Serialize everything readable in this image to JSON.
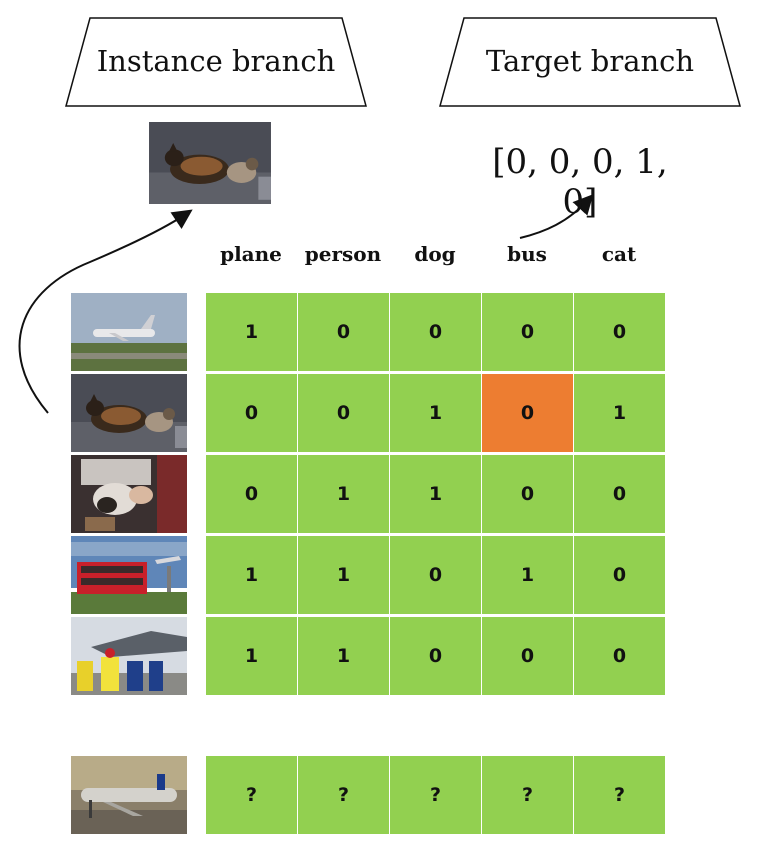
{
  "instance_branch": {
    "label": "Instance branch"
  },
  "target_branch": {
    "label": "Target branch",
    "vector": "[0, 0, 0, 1, 0]"
  },
  "columns": [
    "plane",
    "person",
    "dog",
    "bus",
    "cat"
  ],
  "rows": [
    {
      "image": "airplane-photo",
      "values": [
        "1",
        "0",
        "0",
        "0",
        "0"
      ]
    },
    {
      "image": "dog-and-cat-photo",
      "values": [
        "0",
        "0",
        "1",
        "0",
        "1"
      ],
      "highlight_col": 3
    },
    {
      "image": "person-with-dog-photo",
      "values": [
        "0",
        "1",
        "1",
        "0",
        "0"
      ]
    },
    {
      "image": "bus-and-plane-photo",
      "values": [
        "1",
        "1",
        "0",
        "1",
        "0"
      ]
    },
    {
      "image": "people-and-jet-photo",
      "values": [
        "1",
        "1",
        "0",
        "0",
        "0"
      ]
    }
  ],
  "query_row": {
    "image": "airliner-at-gate-photo",
    "values": [
      "?",
      "?",
      "?",
      "?",
      "?"
    ]
  },
  "colors": {
    "cell": "#92d050",
    "highlight": "#ed7d31",
    "line": "#111111"
  }
}
